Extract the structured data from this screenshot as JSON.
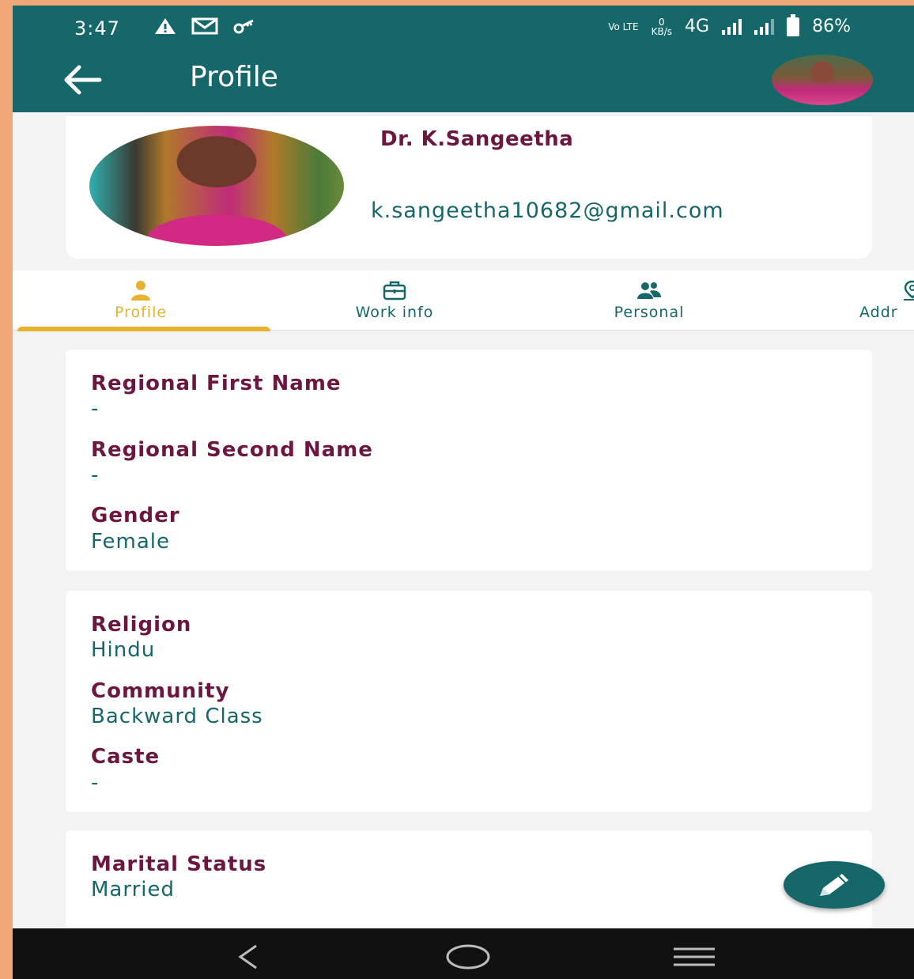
{
  "status_bar": {
    "time": "3:47",
    "left_icons": [
      "warning-icon",
      "gmail-icon",
      "key-icon"
    ],
    "volte": "Vo LTE",
    "speed_value": "0",
    "speed_unit": "KB/s",
    "network": "4G",
    "battery": "86%"
  },
  "app_bar": {
    "title": "Profile",
    "back_icon": "arrow-left-icon"
  },
  "profile": {
    "name": "Dr. K.Sangeetha",
    "email": "k.sangeetha10682@gmail.com"
  },
  "tabs": [
    {
      "label": "Profile",
      "icon": "person-icon",
      "active": true
    },
    {
      "label": "Work info",
      "icon": "briefcase-icon",
      "active": false
    },
    {
      "label": "Personal",
      "icon": "people-icon",
      "active": false
    },
    {
      "label": "Addr",
      "icon": "location-icon",
      "active": false
    }
  ],
  "cards": {
    "names": [
      {
        "label": "Regional First Name",
        "value": "-"
      },
      {
        "label": "Regional Second Name",
        "value": "-"
      },
      {
        "label": "Gender",
        "value": "Female"
      }
    ],
    "religion": [
      {
        "label": "Religion",
        "value": "Hindu"
      },
      {
        "label": "Community",
        "value": "Backward Class"
      },
      {
        "label": "Caste",
        "value": "-"
      }
    ],
    "marital": [
      {
        "label": "Marital Status",
        "value": "Married"
      }
    ]
  },
  "colors": {
    "primary": "#15676a",
    "label": "#6b1740",
    "accent": "#e6b230"
  },
  "fab_icon": "edit-pencil-icon",
  "nav_icons": [
    "back-nav-icon",
    "home-nav-icon",
    "recents-nav-icon"
  ]
}
